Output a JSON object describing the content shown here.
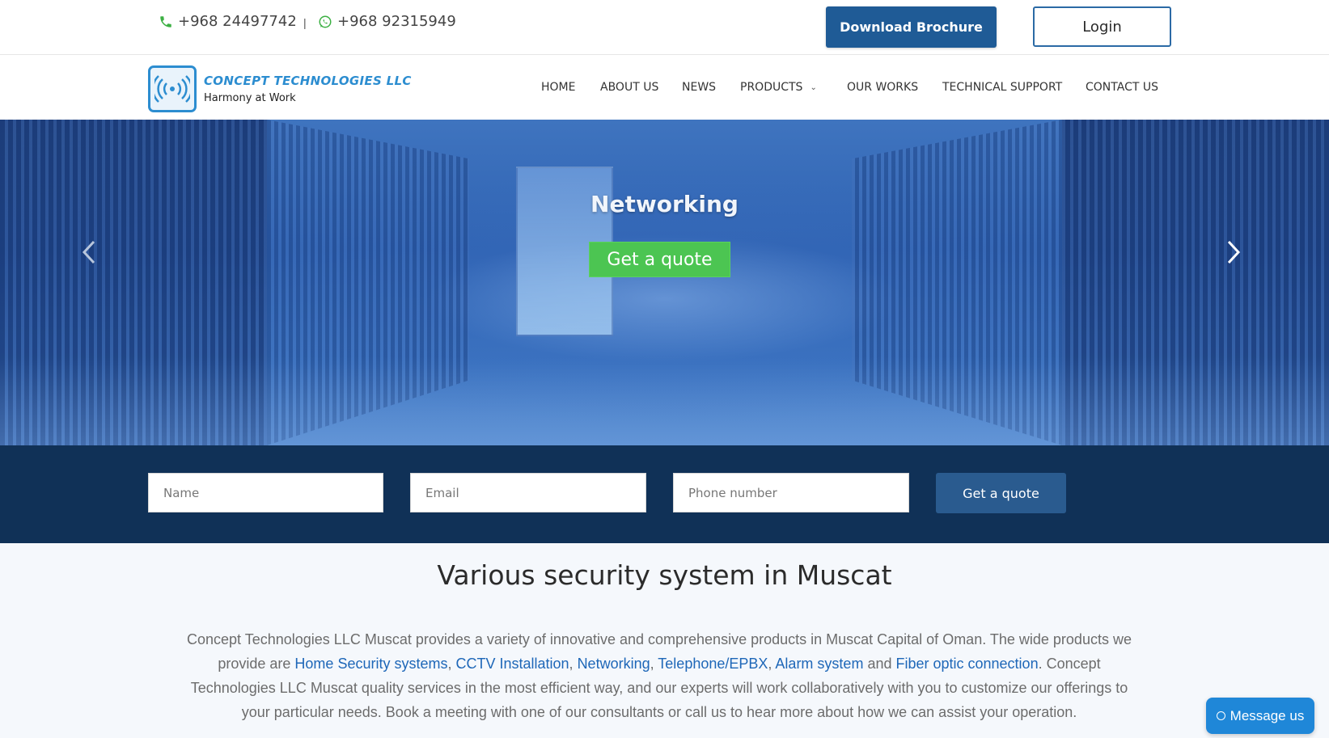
{
  "topbar": {
    "phone": "+968 24497742",
    "separator": "|",
    "whatsapp": "+968 92315949",
    "brochure_label": "Download Brochure",
    "login_label": "Login"
  },
  "brand": {
    "name": "CONCEPT TECHNOLOGIES LLC",
    "tagline": "Harmony at Work"
  },
  "nav": {
    "items": [
      "HOME",
      "ABOUT US",
      "NEWS",
      "PRODUCTS",
      "OUR WORKS",
      "TECHNICAL SUPPORT",
      "CONTACT US"
    ]
  },
  "hero": {
    "title": "Networking",
    "cta_label": "Get a quote"
  },
  "quote_form": {
    "name_placeholder": "Name",
    "email_placeholder": "Email",
    "phone_placeholder": "Phone number",
    "submit_label": "Get a quote"
  },
  "section": {
    "title": "Various security system in Muscat",
    "para_part1": "Concept Technologies LLC Muscat provides a variety of innovative and comprehensive products in Muscat Capital of Oman. The wide products we provide are ",
    "links": [
      "Home Security systems",
      "CCTV Installation",
      "Networking",
      "Telephone/EPBX",
      "Alarm system",
      "Fiber optic connection"
    ],
    "sep_comma": ", ",
    "sep_and": " and ",
    "para_part2": ". Concept Technologies LLC Muscat quality services in the most efficient way, and our experts will work collaboratively with you to customize our offerings to your particular needs. Book a meeting with one of our consultants or call us to hear more about how we can assist your operation."
  },
  "chat": {
    "label": "Message us"
  },
  "colors": {
    "primary": "#1f5b96",
    "dark_strip": "#103157",
    "green_cta": "#4cc552",
    "link": "#1e67b8",
    "chat": "#1f87d8"
  }
}
